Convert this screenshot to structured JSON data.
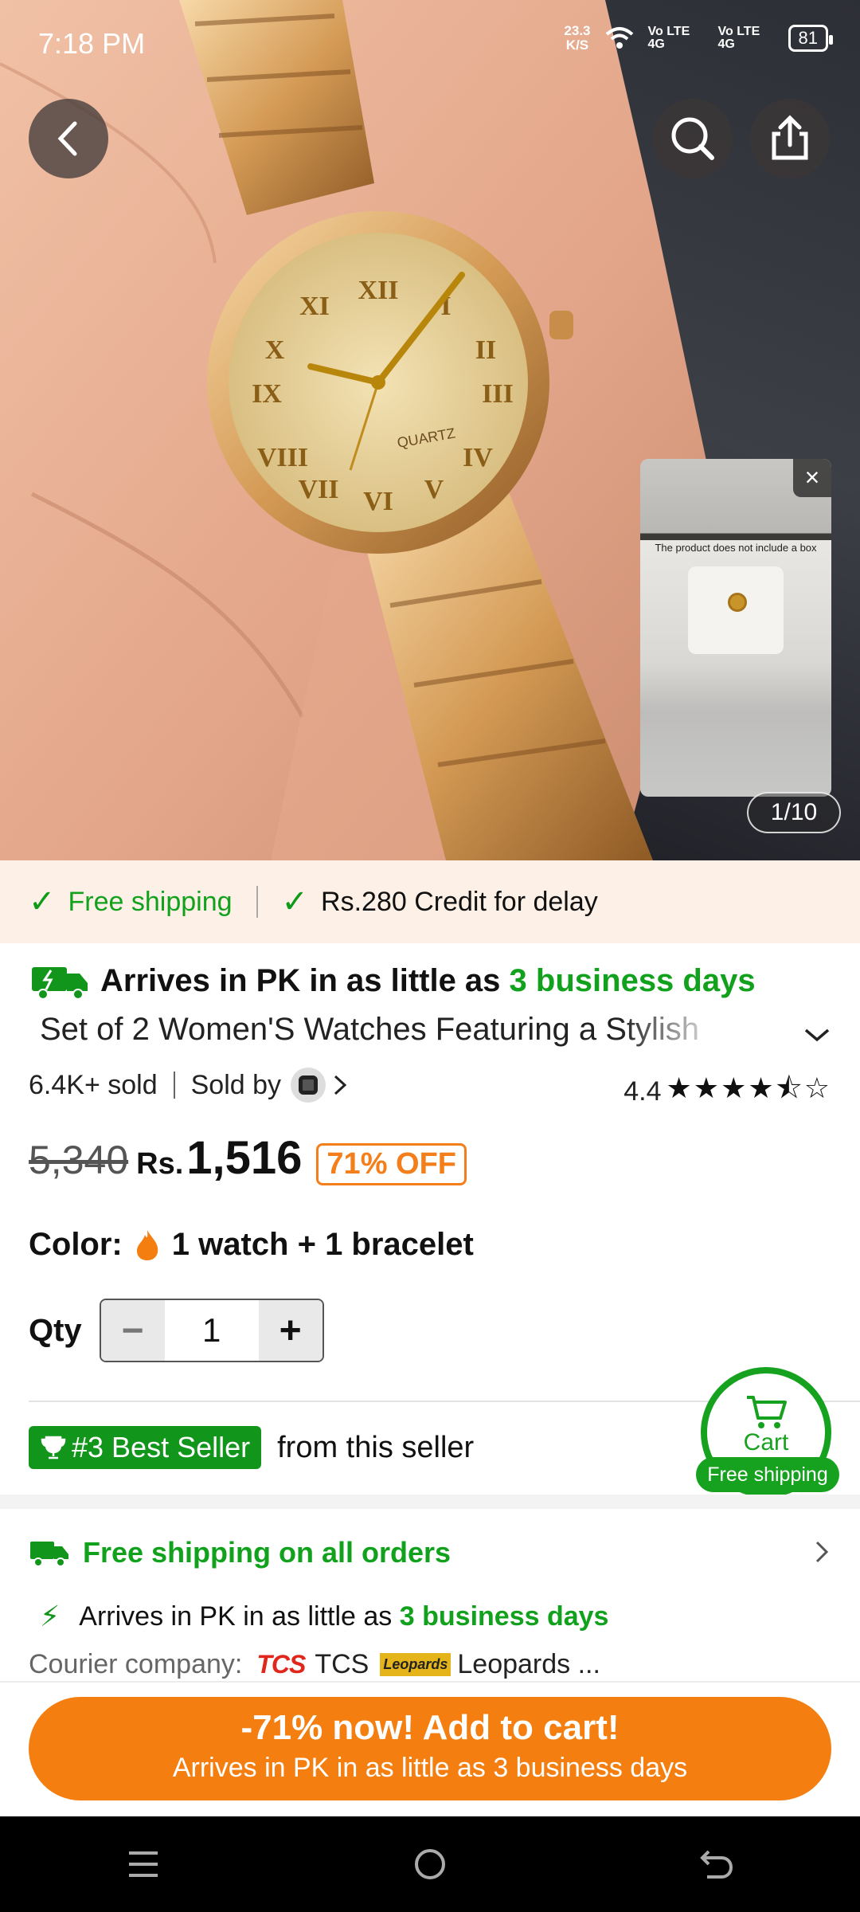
{
  "status_bar": {
    "time": "7:18 PM",
    "net_speed_value": "23.3",
    "net_speed_unit": "K/S",
    "battery": "81",
    "signal1": "Vo LTE 4G",
    "signal2": "Vo LTE 4G"
  },
  "gallery": {
    "counter": "1/10",
    "video_caption": "The product does not include a box"
  },
  "shipping_strip": {
    "free_shipping": "Free shipping",
    "credit": "Rs.280 Credit for delay"
  },
  "product": {
    "arrive_prefix": "Arrives in PK in as little as ",
    "arrive_days": "3 business days",
    "title": "Set of 2 Women'S Watches Featuring a Stylish",
    "sold": "6.4K+ sold",
    "sold_by": "Sold by",
    "rating": "4.4",
    "old_price": "5,340",
    "currency": "Rs.",
    "price": "1,516",
    "discount": "71% OFF",
    "color_label": "Color:",
    "color_value": "1 watch + 1 bracelet",
    "qty_label": "Qty",
    "qty_value": "1",
    "best_seller": "#3 Best Seller",
    "best_seller_suffix": "from this seller"
  },
  "cart_fab": {
    "label": "Cart",
    "ship": "Free shipping"
  },
  "shipping_info": {
    "free_all": "Free shipping on all orders",
    "arrive_prefix": "Arrives in PK in as little as ",
    "arrive_days": "3 business days",
    "courier_label": "Courier company:",
    "tcs_logo": "TCS",
    "tcs": "TCS",
    "leopards_logo": "Leopards",
    "leopards": "Leopards ..."
  },
  "cta": {
    "main": "-71% now! Add to cart!",
    "sub": "Arrives in PK in as little as 3 business days"
  },
  "colors": {
    "accent_orange": "#f47f10",
    "green": "#11a11d"
  }
}
